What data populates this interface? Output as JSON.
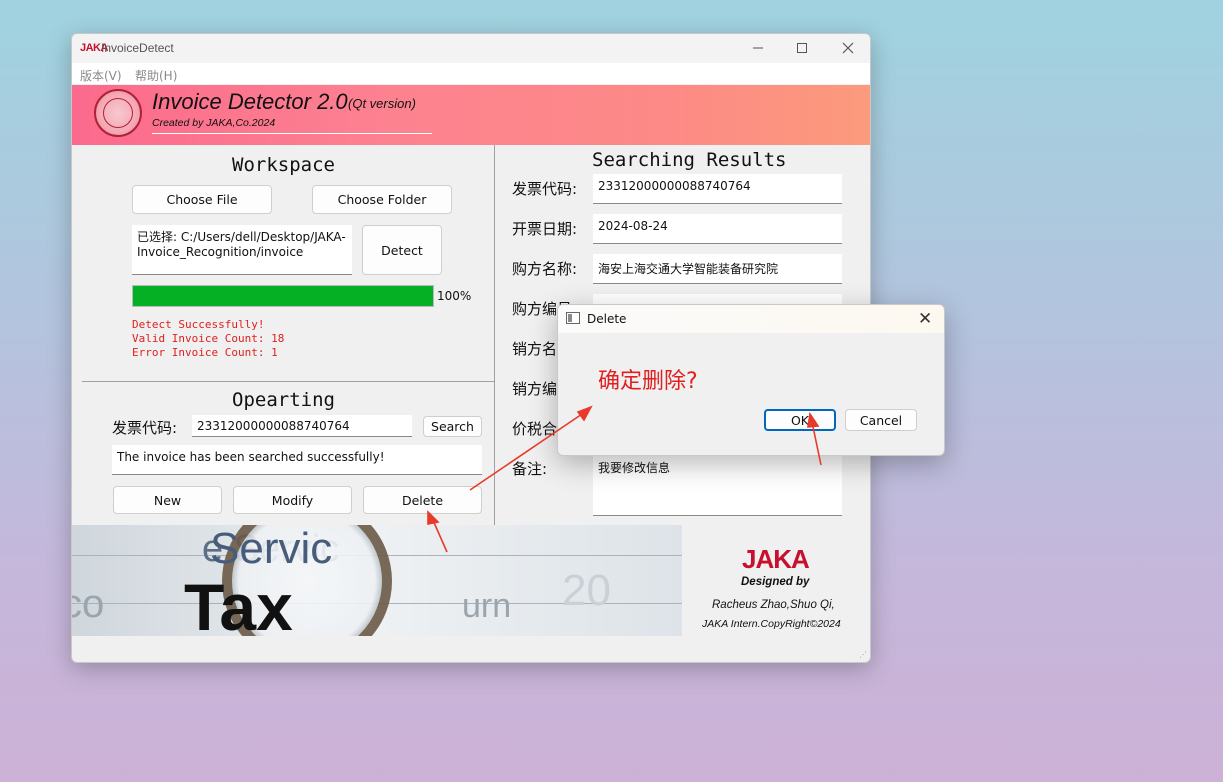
{
  "window": {
    "app_logo": "JAKA",
    "title": "InvoiceDetect",
    "menu": [
      "版本(V)",
      "帮助(H)"
    ]
  },
  "banner": {
    "title": "Invoice Detector 2.0",
    "subtitle": "(Qt version)",
    "credit": "Created by JAKA,Co.2024"
  },
  "workspace": {
    "title": "Workspace",
    "choose_file": "Choose File",
    "choose_folder": "Choose Folder",
    "selected_path": "已选择: C:/Users/dell/Desktop/JAKA-Invoice_Recognition/invoice",
    "detect": "Detect",
    "progress_percent": 100,
    "progress_label": "100%",
    "log": [
      "Detect Successfully!",
      "Valid Invoice Count: 18",
      "Error Invoice Count: 1"
    ]
  },
  "operating": {
    "title": "Opearting",
    "code_label": "发票代码:",
    "code_value": "23312000000088740764",
    "search": "Search",
    "message": "The invoice has been searched successfully!",
    "new": "New",
    "modify": "Modify",
    "delete": "Delete"
  },
  "results": {
    "title": "Searching Results",
    "fields": [
      {
        "label": "发票代码:",
        "value": "23312000000088740764"
      },
      {
        "label": "开票日期:",
        "value": "2024-08-24"
      },
      {
        "label": "购方名称:",
        "value": "海安上海交通大学智能装备研究院"
      },
      {
        "label": "购方编号",
        "value": ""
      },
      {
        "label": "销方名",
        "value": ""
      },
      {
        "label": "销方编",
        "value": ""
      },
      {
        "label": "价税合",
        "value": ""
      },
      {
        "label": "备注:",
        "value": "我要修改信息"
      }
    ]
  },
  "footer": {
    "logo": "JAKA",
    "designed_by": "Designed by",
    "authors": "Racheus Zhao,Shuo Qi,",
    "copyright": "JAKA Intern.CopyRight©2024"
  },
  "dialog": {
    "title": "Delete",
    "message": "确定删除?",
    "ok": "OK",
    "cancel": "Cancel"
  },
  "colors": {
    "accent_red": "#e0201f",
    "progress_green": "#06b025",
    "focus_blue": "#0067c0",
    "brand_red": "#c8102e"
  }
}
